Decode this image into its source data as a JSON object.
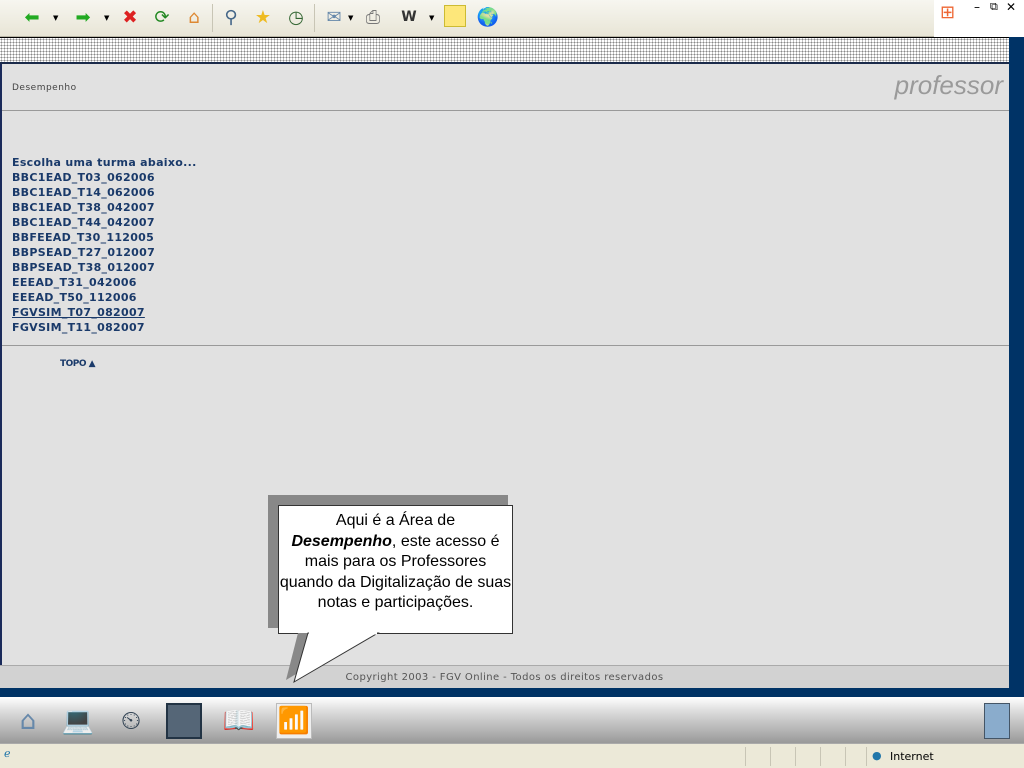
{
  "toolbar": {
    "icons": [
      "back-icon",
      "forward-icon",
      "stop-icon",
      "refresh-icon",
      "home-icon",
      "search-icon",
      "favorites-icon",
      "history-icon",
      "mail-icon",
      "print-icon",
      "word-icon",
      "note-icon",
      "messenger-icon"
    ]
  },
  "header": {
    "title": "Desempenho",
    "brand": "professor"
  },
  "main": {
    "prompt": "Escolha uma turma abaixo...",
    "classes": [
      "BBC1EAD_T03_062006",
      "BBC1EAD_T14_062006",
      "BBC1EAD_T38_042007",
      "BBC1EAD_T44_042007",
      "BBFEEAD_T30_112005",
      "BBPSEAD_T27_012007",
      "BBPSEAD_T38_012007",
      "EEEAD_T31_042006",
      "EEEAD_T50_112006",
      "FGVSIM_T07_082007",
      "FGVSIM_T11_082007"
    ],
    "top_link": "TOPO ▲"
  },
  "footer": {
    "copyright": "Copyright 2003 - FGV Online - Todos os direitos reservados"
  },
  "callout": {
    "line1": "Aqui é a Área de",
    "bold": "Desempenho",
    "rest": ", este acesso é mais para os Professores quando da Digitalização de suas notas e participações."
  },
  "status": {
    "zone": "Internet"
  }
}
